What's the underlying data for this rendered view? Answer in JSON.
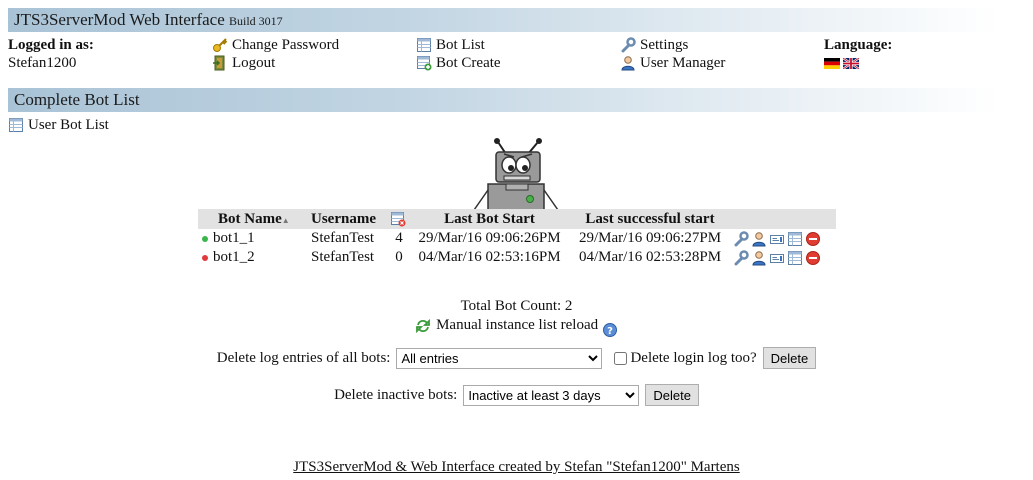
{
  "app": {
    "title": "JTS3ServerMod Web Interface",
    "build": "Build 3017"
  },
  "header": {
    "logged_in_label": "Logged in as:",
    "username": "Stefan1200",
    "change_password": "Change Password",
    "logout": "Logout",
    "bot_list": "Bot List",
    "bot_create": "Bot Create",
    "settings": "Settings",
    "user_manager": "User Manager",
    "language_label": "Language:"
  },
  "section": {
    "title": "Complete Bot List",
    "user_bot_list": "User Bot List"
  },
  "table": {
    "headers": {
      "bot_name": "Bot Name",
      "username": "Username",
      "last_start": "Last Bot Start",
      "last_success": "Last successful start"
    },
    "rows": [
      {
        "name": "bot1_1",
        "username": "StefanTest",
        "count": "4",
        "last_start": "29/Mar/16 09:06:26PM",
        "last_success": "29/Mar/16 09:06:27PM",
        "status_color": "#39b54a"
      },
      {
        "name": "bot1_2",
        "username": "StefanTest",
        "count": "0",
        "last_start": "04/Mar/16 02:53:16PM",
        "last_success": "04/Mar/16 02:53:28PM",
        "status_color": "#e0393e"
      }
    ]
  },
  "summary": {
    "total_label": "Total Bot Count: 2",
    "reload": "Manual instance list reload"
  },
  "delete_log": {
    "label": "Delete log entries of all bots:",
    "selected": "All entries",
    "checkbox_label": "Delete login log too?",
    "button": "Delete"
  },
  "delete_inactive": {
    "label": "Delete inactive bots:",
    "selected": "Inactive at least 3 days",
    "button": "Delete"
  },
  "footer": {
    "text": "JTS3ServerMod & Web Interface created by Stefan \"Stefan1200\" Martens"
  }
}
